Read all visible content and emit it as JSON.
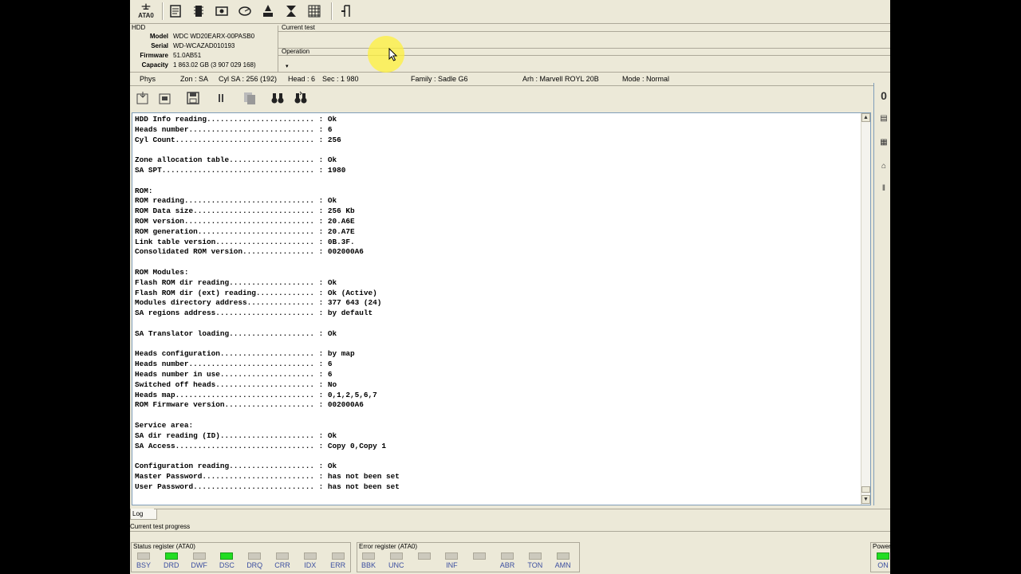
{
  "toolbar": {
    "ata_label": "ATA0",
    "buttons": [
      "scan-icon",
      "chip-icon",
      "drive-settings-icon",
      "disk-icon",
      "flash-icon",
      "format-icon",
      "grid-icon",
      "exit-icon"
    ]
  },
  "hdd": {
    "title": "HDD",
    "rows": [
      {
        "key": "Model",
        "value": "WDC WD20EARX-00PASB0"
      },
      {
        "key": "Serial",
        "value": "WD-WCAZAD010193"
      },
      {
        "key": "Firmware",
        "value": "51.0AB51"
      },
      {
        "key": "Capacity",
        "value": "1 863.02 GB (3 907 029 168)"
      }
    ]
  },
  "current_test_label": "Current test",
  "operation_label": "Operation",
  "statusline": {
    "phys": "Phys",
    "zon": "Zon : SA",
    "cyl": "Cyl SA : 256 (192)",
    "head": "Head : 6",
    "sec": "Sec : 1 980",
    "family": "Family : Sadle G6",
    "arh": "Arh : Marvell ROYL 20B",
    "mode": "Mode : Normal"
  },
  "log_lines": [
    "HDD Info reading........................ : Ok",
    "Heads number............................ : 6",
    "Cyl Count............................... : 256",
    "",
    "Zone allocation table................... : Ok",
    "SA SPT.................................. : 1980",
    "",
    "ROM:",
    "ROM reading............................. : Ok",
    "ROM Data size........................... : 256 Kb",
    "ROM version............................. : 20.A6E",
    "ROM generation.......................... : 20.A7E",
    "Link table version...................... : 0B.3F.",
    "Consolidated ROM version................ : 002000A6",
    "",
    "ROM Modules:",
    "Flash ROM dir reading................... : Ok",
    "Flash ROM dir (ext) reading............. : Ok (Active)",
    "Modules directory address............... : 377 643 (24)",
    "SA regions address...................... : by default",
    "",
    "SA Translator loading................... : Ok",
    "",
    "Heads configuration..................... : by map",
    "Heads number............................ : 6",
    "Heads number in use..................... : 6",
    "Switched off heads...................... : No",
    "Heads map............................... : 0,1,2,5,6,7",
    "ROM Firmware version.................... : 002000A6",
    "",
    "Service area:",
    "SA dir reading (ID)..................... : Ok",
    "SA Access............................... : Copy 0,Copy 1",
    "",
    "Configuration reading................... : Ok",
    "Master Password......................... : has not been set",
    "User Password........................... : has not been set"
  ],
  "log_tab_label": "Log",
  "progress_label": "Current test progress",
  "status_register": {
    "title": "Status register (ATA0)",
    "leds": [
      {
        "name": "BSY",
        "on": false
      },
      {
        "name": "DRD",
        "on": true
      },
      {
        "name": "DWF",
        "on": false
      },
      {
        "name": "DSC",
        "on": true
      },
      {
        "name": "DRQ",
        "on": false
      },
      {
        "name": "CRR",
        "on": false
      },
      {
        "name": "IDX",
        "on": false
      },
      {
        "name": "ERR",
        "on": false
      }
    ]
  },
  "error_register": {
    "title": "Error register (ATA0)",
    "leds": [
      {
        "name": "BBK",
        "on": false
      },
      {
        "name": "UNC",
        "on": false
      },
      {
        "name": "",
        "on": false
      },
      {
        "name": "INF",
        "on": false
      },
      {
        "name": "",
        "on": false
      },
      {
        "name": "ABR",
        "on": false
      },
      {
        "name": "TON",
        "on": false
      },
      {
        "name": "AMN",
        "on": false
      }
    ]
  },
  "power": {
    "title": "Power",
    "label": "ON",
    "on": true
  },
  "right_panel_top": "0",
  "colors": {
    "led_on": "#22dd22",
    "led_off": "#ccc9bd",
    "led_label": "#3c4fa0"
  }
}
